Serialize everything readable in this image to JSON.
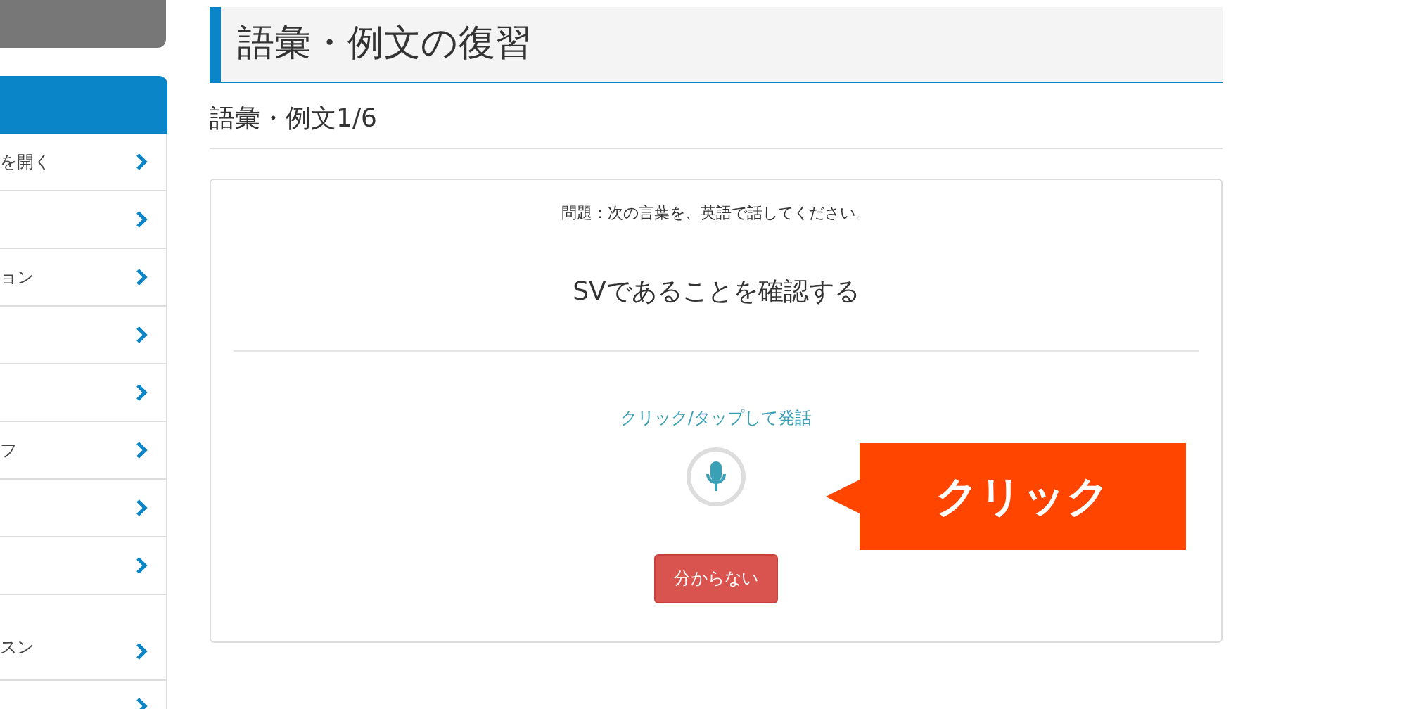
{
  "sidebar": {
    "items": [
      {
        "label": "を開く",
        "kind": "normal"
      },
      {
        "kind": "normal"
      },
      {
        "label": "ョン",
        "kind": "normal"
      },
      {
        "kind": "normal"
      },
      {
        "kind": "normal"
      },
      {
        "label": "フ",
        "kind": "normal"
      },
      {
        "kind": "normal"
      },
      {
        "kind": "normal"
      },
      {
        "label": "スン",
        "kind": "tall"
      },
      {
        "kind": "cut"
      }
    ]
  },
  "page_title": "語彙・例文の復習",
  "section_title": "語彙・例文1/6",
  "card": {
    "question": "問題：次の言葉を、英語で話してください。",
    "prompt": "SVであることを確認する",
    "speak_hint": "クリック/タップして発話",
    "dont_know_button": "分からない"
  },
  "callout": {
    "text": "クリック"
  }
}
